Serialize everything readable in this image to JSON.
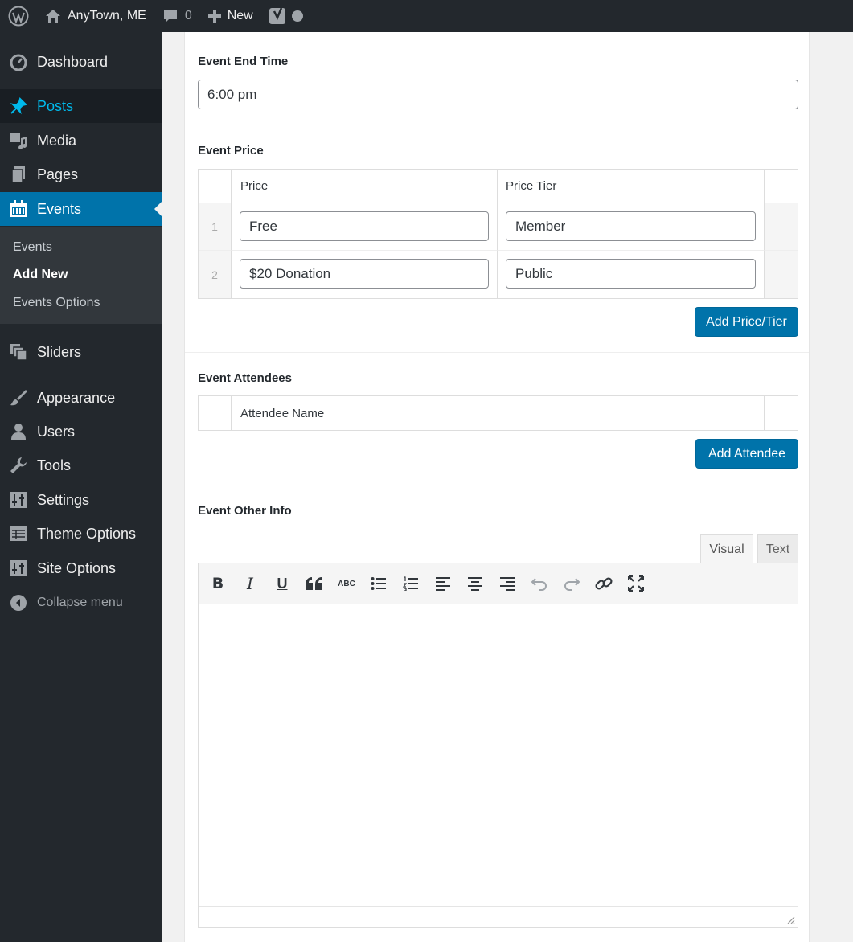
{
  "adminbar": {
    "site_name": "AnyTown, ME",
    "comments_count": "0",
    "new_label": "New"
  },
  "sidebar": {
    "items": [
      {
        "label": "Dashboard",
        "icon": "dashboard-icon"
      },
      {
        "label": "Posts",
        "icon": "pin-icon"
      },
      {
        "label": "Media",
        "icon": "media-icon"
      },
      {
        "label": "Pages",
        "icon": "pages-icon"
      },
      {
        "label": "Events",
        "icon": "calendar-icon"
      },
      {
        "label": "Sliders",
        "icon": "sliders-icon"
      },
      {
        "label": "Appearance",
        "icon": "paintbrush-icon"
      },
      {
        "label": "Users",
        "icon": "user-icon"
      },
      {
        "label": "Tools",
        "icon": "wrench-icon"
      },
      {
        "label": "Settings",
        "icon": "settings-icon"
      },
      {
        "label": "Theme Options",
        "icon": "table-icon"
      },
      {
        "label": "Site Options",
        "icon": "settings-icon"
      }
    ],
    "submenu": [
      "Events",
      "Add New",
      "Events Options"
    ],
    "collapse_label": "Collapse menu"
  },
  "main": {
    "end_time": {
      "label": "Event End Time",
      "value": "6:00 pm"
    },
    "price": {
      "label": "Event Price",
      "columns": [
        "Price",
        "Price Tier"
      ],
      "rows": [
        {
          "num": "1",
          "price": "Free",
          "tier": "Member"
        },
        {
          "num": "2",
          "price": "$20 Donation",
          "tier": "Public"
        }
      ],
      "add_button": "Add Price/Tier"
    },
    "attendees": {
      "label": "Event Attendees",
      "columns": [
        "Attendee Name"
      ],
      "add_button": "Add Attendee"
    },
    "other_info": {
      "label": "Event Other Info",
      "tabs": [
        "Visual",
        "Text"
      ],
      "toolbar": [
        "bold",
        "italic",
        "underline",
        "blockquote",
        "strikethrough",
        "bulleted-list",
        "numbered-list",
        "align-left",
        "align-center",
        "align-right",
        "undo",
        "redo",
        "link",
        "fullscreen"
      ],
      "strike_text": "ABC"
    }
  },
  "colors": {
    "accent": "#0073aa",
    "sidebar_bg": "#23282d",
    "posts_highlight": "#00b9eb"
  }
}
